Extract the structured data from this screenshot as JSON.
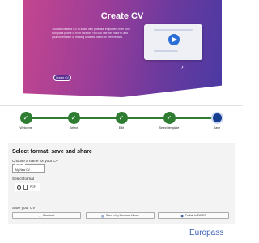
{
  "hero": {
    "title": "Create CV",
    "description": "You can create a CV to share with potential employers from your Europass profile or from scratch. You can use the editor to add your information or making updates based on preferences.",
    "button_label": "Create CV",
    "prev_icon": "chevron-left-icon",
    "next_icon": "chevron-right-icon"
  },
  "steps": [
    {
      "label": "Welcome",
      "status": "done"
    },
    {
      "label": "Select",
      "status": "done"
    },
    {
      "label": "Edit",
      "status": "done"
    },
    {
      "label": "Select template",
      "status": "done"
    },
    {
      "label": "Save",
      "status": "current"
    }
  ],
  "save_panel": {
    "title": "Select format, save and share",
    "name_label": "Choose a name for your CV",
    "name_field_caption": "Name *",
    "name_value": "My New CV",
    "format_label": "Select format",
    "format_option": "PDF",
    "save_label": "Save your CV",
    "buttons": [
      {
        "label": "Download",
        "icon": "download-icon"
      },
      {
        "label": "Save in My Europass Library",
        "icon": "library-icon"
      },
      {
        "label": "Publish to EURES",
        "icon": "globe-icon"
      }
    ]
  },
  "brand": "Europass",
  "colors": {
    "accent": "#163e90",
    "done": "#2e7d32",
    "brand": "#3d62b5"
  }
}
